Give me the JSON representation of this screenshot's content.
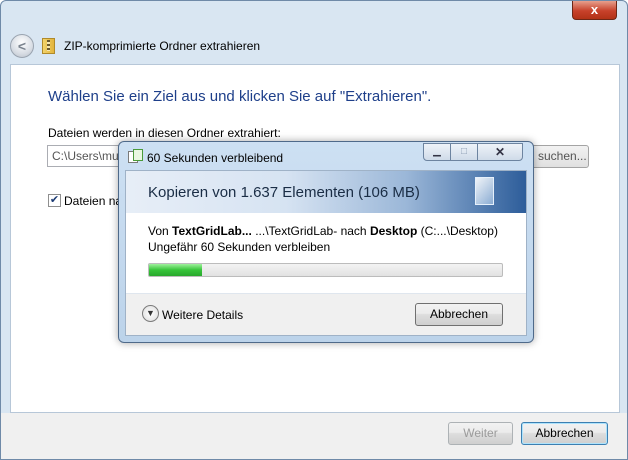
{
  "wizard": {
    "title": "ZIP-komprimierte Ordner extrahieren",
    "close_label": "x",
    "back_glyph": "<",
    "heading": "Wählen Sie ein Ziel aus und klicken Sie auf \"Extrahieren\".",
    "destination_label": "Dateien werden in diesen Ordner extrahiert:",
    "destination_value": "C:\\Users\\mu",
    "browse_label": "suchen...",
    "show_files_label": "Dateien na",
    "show_files_checked": true,
    "next_label": "Weiter",
    "cancel_label": "Abbrechen"
  },
  "progress_dialog": {
    "title": "60 Sekunden verbleibend",
    "heading": "Kopieren von 1.637 Elementen (106 MB)",
    "from_prefix": "Von",
    "source_name": "TextGridLab...",
    "source_path": "...\\TextGridLab-",
    "to_word": "nach",
    "dest_name": "Desktop",
    "dest_path": "(C:...\\Desktop)",
    "remaining_text": "Ungefähr 60 Sekunden verbleiben",
    "progress_fraction": 0.15,
    "details_label": "Weitere Details",
    "cancel_label": "Abbrechen"
  },
  "icons": {
    "back": "back-arrow-icon",
    "zip": "zip-folder-icon",
    "copy": "copy-icon",
    "details": "chevron-down-icon"
  }
}
